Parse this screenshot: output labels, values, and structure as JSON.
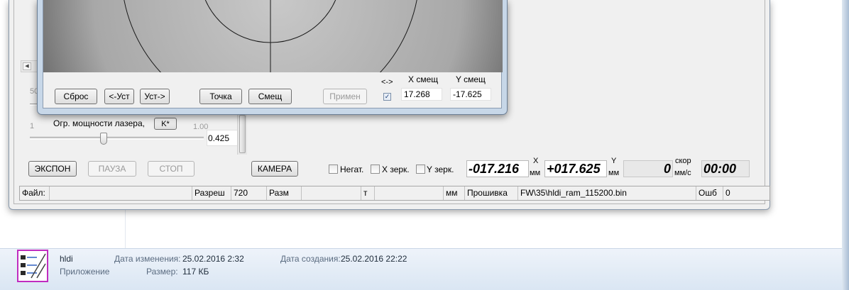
{
  "main": {
    "slider_top_min": "50",
    "laser": {
      "min": "1",
      "label": "Огр. мощности лазера,",
      "k_button": "K*",
      "max": "1.00",
      "value": "0.425",
      "slider_position": 0.42
    },
    "buttons": {
      "expon": "ЭКСПОН",
      "pause": "ПАУЗА",
      "stop": "СТОП",
      "camera": "КАМЕРА"
    },
    "checkboxes": {
      "negative": "Негат.",
      "x_mirror": "X зерк.",
      "y_mirror": "Y зерк."
    },
    "readouts": {
      "x_value": "-017.216",
      "x_axis": "X",
      "x_unit": "мм",
      "y_value": "+017.625",
      "y_axis": "Y",
      "y_unit": "мм",
      "speed_value": "0",
      "speed_label": "скор",
      "speed_unit": "мм/с",
      "timer": "00:00"
    },
    "status_bar": {
      "file_label": "Файл:",
      "resolution_label": "Разреш",
      "resolution_value": "720",
      "size_label": "Разм",
      "t_label": "т",
      "mm_label": "мм",
      "firmware_label": "Прошивка",
      "firmware_value": "FW\\35\\hldi_ram_115200.bin",
      "error_label": "Ошб",
      "error_value": "0"
    }
  },
  "dialog": {
    "buttons": {
      "reset": "Сброс",
      "set_left": "<-Уст",
      "set_right": "Уст->",
      "point": "Точка",
      "shift": "Смещ",
      "apply": "Примен"
    },
    "swap_label": "<->",
    "swap_checked": true,
    "x_shift_label": "X смещ",
    "y_shift_label": "Y смещ",
    "x_shift_value": "17.268",
    "y_shift_value": "-17.625"
  },
  "details": {
    "file_name": "hldi",
    "file_type": "Приложение",
    "modified_label": "Дата изменения:",
    "modified_value": "25.02.2016 2:32",
    "size_label": "Размер:",
    "size_value": "117 КБ",
    "created_label": "Дата создания:",
    "created_value": "25.02.2016 22:22"
  },
  "colors": {
    "dialog_frame": "#c7d7e8",
    "icon_border": "#c02cc0",
    "details_pane": "#dae6f3"
  }
}
